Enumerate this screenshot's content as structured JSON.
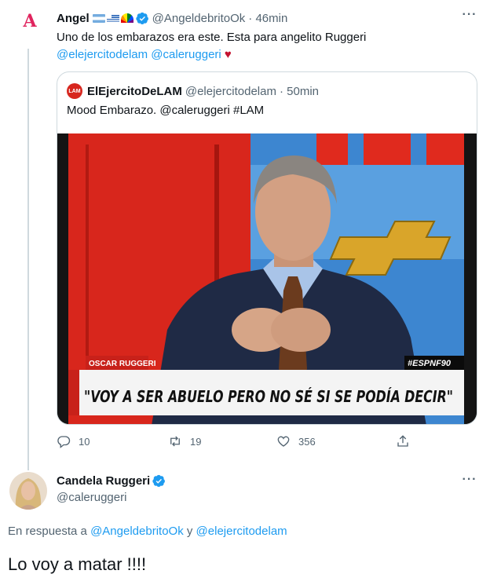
{
  "tweet": {
    "avatar_letter": "A",
    "author_name": "Angel",
    "author_handle": "@AngeldebritoOk",
    "time": "· 46min",
    "text": "Uno de los embarazos era este. Esta para angelito Ruggeri",
    "mentions": [
      "@elejercitodelam",
      "@caleruggeri"
    ],
    "heart": "♥",
    "more": "···"
  },
  "quote": {
    "avatar_text": "LAM",
    "author_name": "ElEjercitoDeLAM",
    "author_handle": "@elejercitodelam",
    "time": "· 50min",
    "text": "Mood Embarazo. @caleruggeri #LAM",
    "media": {
      "lower_third_name": "OSCAR RUGGERI",
      "hashtag": "#ESPNF90",
      "caption": "\"VOY A SER ABUELO PERO NO SÉ SI SE PODÍA DECIR\""
    }
  },
  "actions": {
    "replies": "10",
    "retweets": "19",
    "likes": "356"
  },
  "reply": {
    "author_name": "Candela Ruggeri",
    "author_handle": "@caleruggeri",
    "more": "···",
    "replying_to_prefix": "En respuesta a",
    "replying_to_user1": "@AngeldebritoOk",
    "replying_to_and": "y",
    "replying_to_user2": "@elejercitodelam",
    "text": "Lo voy a matar !!!!"
  },
  "colors": {
    "link": "#1d9bf0",
    "verified": "#1d9bf0",
    "secondary_text": "#536471",
    "border": "#cfd9de"
  }
}
